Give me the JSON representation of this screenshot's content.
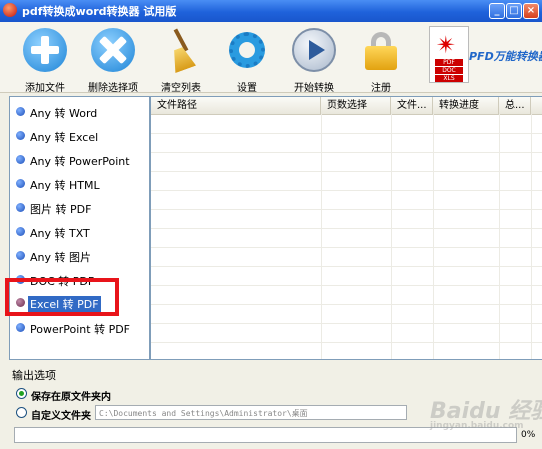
{
  "window": {
    "title": "pdf转换成word转换器 试用版",
    "buttons": {
      "minimize": "_",
      "maximize": "□",
      "close": "×"
    }
  },
  "toolbar": [
    {
      "label": "添加文件",
      "icon": "add-icon"
    },
    {
      "label": "删除选择项",
      "icon": "delete-icon"
    },
    {
      "label": "清空列表",
      "icon": "broom-icon"
    },
    {
      "label": "设置",
      "icon": "gear-icon"
    },
    {
      "label": "开始转换",
      "icon": "play-icon"
    },
    {
      "label": "注册",
      "icon": "lock-icon"
    }
  ],
  "logo": {
    "text": "PFD万能转换器",
    "doc_tags": [
      "PDF",
      "DOC",
      "XLS"
    ],
    "icon": "acrobat-icon"
  },
  "modes": [
    {
      "label": "Any 转 Word",
      "selected": false
    },
    {
      "label": "Any 转 Excel",
      "selected": false
    },
    {
      "label": "Any 转 PowerPoint",
      "selected": false
    },
    {
      "label": "Any 转 HTML",
      "selected": false
    },
    {
      "label": "图片 转 PDF",
      "selected": false
    },
    {
      "label": "Any 转 TXT",
      "selected": false
    },
    {
      "label": "Any 转 图片",
      "selected": false
    },
    {
      "label": "DOC 转 PDF",
      "selected": false
    },
    {
      "label": "Excel 转 PDF",
      "selected": true
    },
    {
      "label": "PowerPoint 转 PDF",
      "selected": false
    }
  ],
  "table": {
    "columns": [
      "文件路径",
      "页数选择",
      "文件...",
      "转换进度",
      "总..."
    ],
    "rows": []
  },
  "output": {
    "section_label": "输出选项",
    "option_same_folder": "保存在原文件夹内",
    "option_custom_folder": "自定义文件夹",
    "custom_path": "C:\\Documents and Settings\\Administrator\\桌面",
    "selected": "same_folder"
  },
  "progress": {
    "value": 0,
    "label": "0%"
  },
  "watermark": {
    "text": "Baidu 经验",
    "sub": "jingyan.baidu.com"
  }
}
